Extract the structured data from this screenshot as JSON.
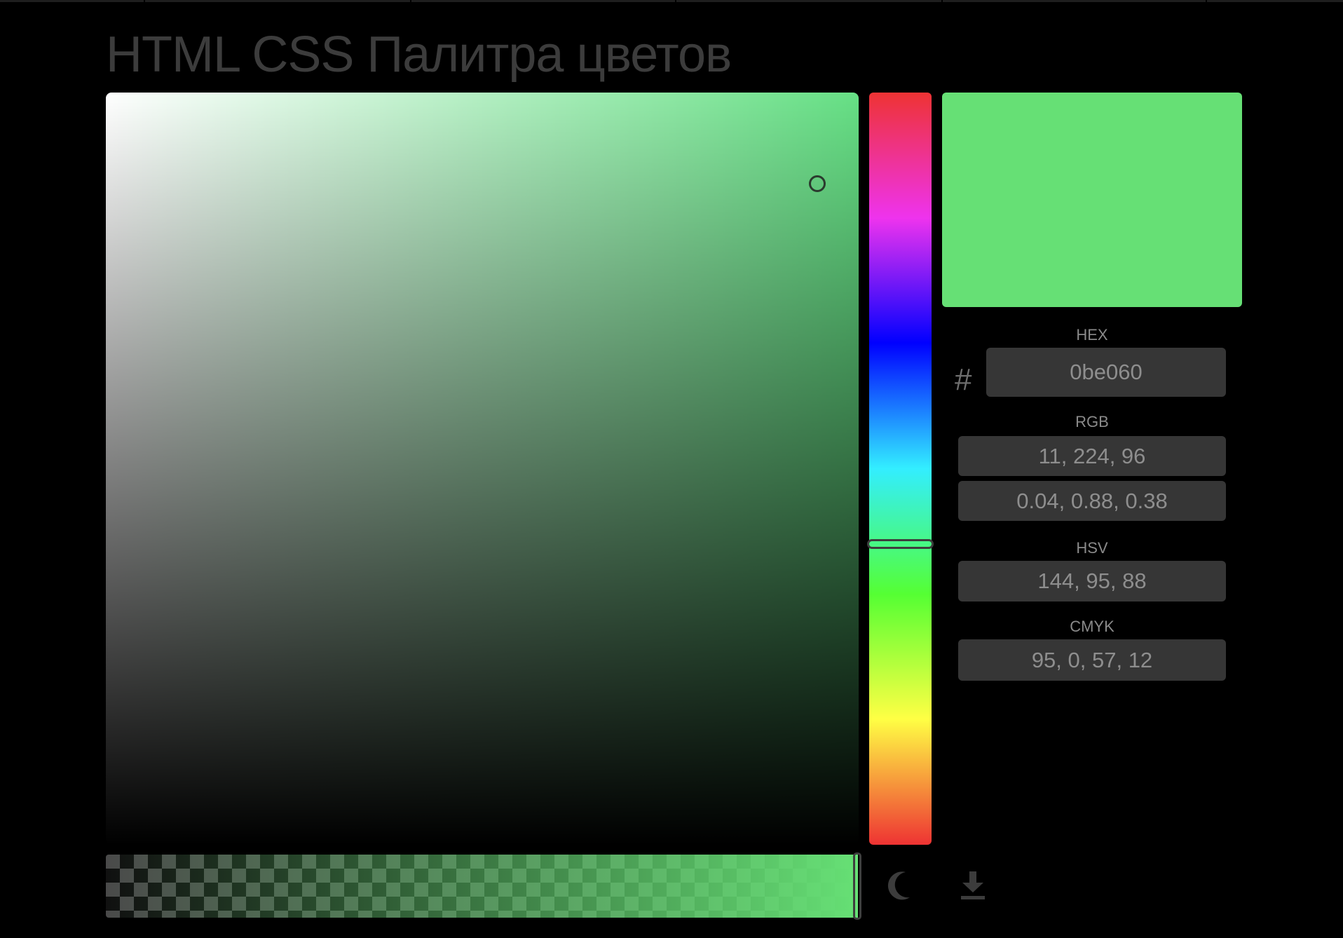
{
  "page": {
    "title": "HTML CSS Палитра цветов"
  },
  "picker": {
    "hue": 144,
    "saturation": 95,
    "value": 88,
    "alpha": 1,
    "preview_color": "#66e075"
  },
  "fields": {
    "hex_label": "HEX",
    "hex_prefix": "#",
    "hex_value": "0be060",
    "rgb_label": "RGB",
    "rgb_value": "11, 224, 96",
    "rgb_normalized_value": "0.04, 0.88, 0.38",
    "hsv_label": "HSV",
    "hsv_value": "144, 95, 88",
    "cmyk_label": "CMYK",
    "cmyk_value": "95, 0, 57, 12"
  },
  "toolbar": {
    "theme_icon": "moon-icon",
    "download_icon": "download-icon"
  },
  "colors": {
    "background": "#000000",
    "field_background": "#363636",
    "field_text": "#8e8e8e",
    "label_text": "#8a8a8a",
    "title_text": "#3c3c3c",
    "handle_border": "#3e3e3e"
  }
}
